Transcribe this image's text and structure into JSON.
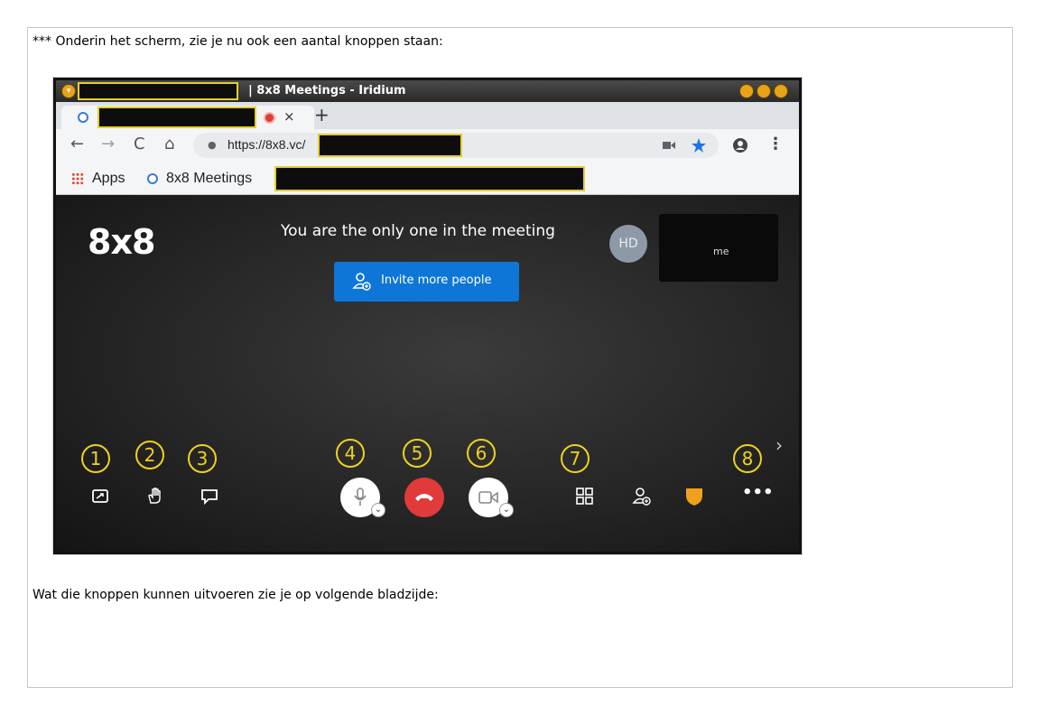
{
  "document": {
    "intro_text": "*** Onderin het scherm, zie je nu ook een aantal knoppen staan:",
    "outro_text": "Wat die knoppen kunnen uitvoeren zie je op volgende bladzijde:"
  },
  "window": {
    "title": "| 8x8 Meetings - Iridium",
    "window_buttons": [
      "minimize",
      "maximize",
      "close"
    ]
  },
  "browser": {
    "tab": {
      "close_symbol": "×",
      "recording": true
    },
    "new_tab_symbol": "+",
    "nav": {
      "back": "←",
      "forward": "→",
      "reload": "C",
      "home": "⌂"
    },
    "url": "https://8x8.vc/",
    "bookmarks": {
      "apps_label": "Apps",
      "meetings_label": "8x8 Meetings"
    }
  },
  "meeting": {
    "logo": "8x8",
    "status_text": "You are the only one in the meeting",
    "invite_label": "Invite more people",
    "avatar_initials": "HD",
    "self_view_label": "me",
    "more_symbol": "•••",
    "panel_chevron": "›",
    "callout_numbers": [
      "1",
      "2",
      "3",
      "4",
      "5",
      "6",
      "7",
      "8"
    ]
  },
  "colors": {
    "invite_button": "#0e76d6",
    "hangup_button": "#e03a3a",
    "callout_yellow": "#f0d21c",
    "shield": "#f0a01c"
  }
}
